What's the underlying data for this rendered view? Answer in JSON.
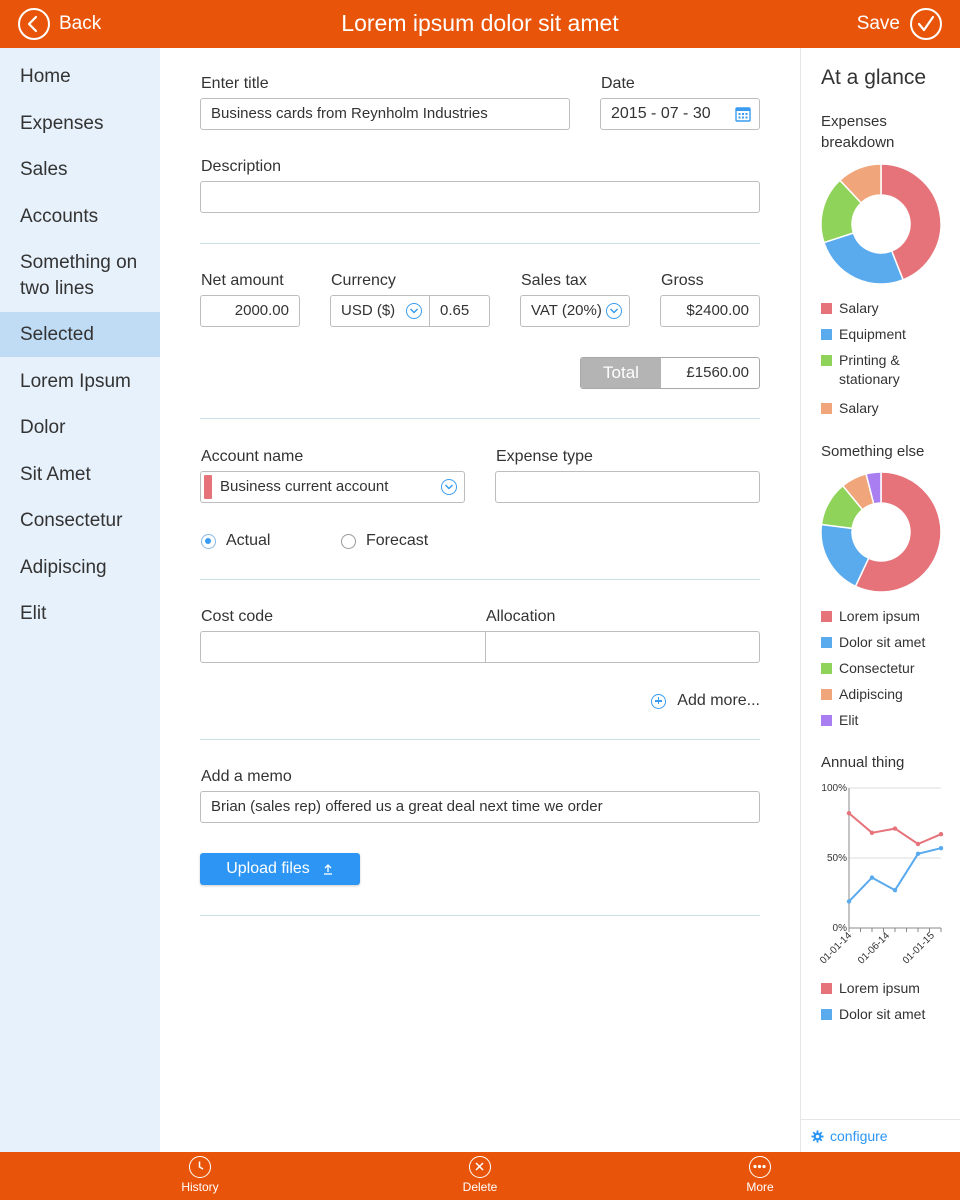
{
  "header": {
    "back_label": "Back",
    "title": "Lorem ipsum dolor sit amet",
    "save_label": "Save",
    "color": "#e8550a"
  },
  "sidebar": {
    "items": [
      {
        "label": "Home"
      },
      {
        "label": "Expenses"
      },
      {
        "label": "Sales"
      },
      {
        "label": "Accounts"
      },
      {
        "label_line1": "Something on",
        "label_line2": "two lines"
      },
      {
        "label": "Selected",
        "selected": true
      },
      {
        "label": "Lorem Ipsum"
      },
      {
        "label": "Dolor"
      },
      {
        "label": "Sit Amet"
      },
      {
        "label": "Consectetur"
      },
      {
        "label": "Adipiscing"
      },
      {
        "label": "Elit"
      }
    ]
  },
  "form": {
    "title_label": "Enter title",
    "title_value": "Business cards from Reynholm Industries",
    "date_label": "Date",
    "date_value": "2015 - 07 - 30",
    "description_label": "Description",
    "description_value": "",
    "net_amount_label": "Net amount",
    "net_amount_value": "2000.00",
    "currency_label": "Currency",
    "currency_value": "USD ($)",
    "exchange_rate": "0.65",
    "sales_tax_label": "Sales tax",
    "sales_tax_value": "VAT (20%)",
    "gross_label": "Gross",
    "gross_value": "$2400.00",
    "total_label": "Total",
    "total_value": "£1560.00",
    "account_name_label": "Account name",
    "account_name_value": "Business current account",
    "expense_type_label": "Expense type",
    "expense_type_value": "",
    "radio_actual": "Actual",
    "radio_forecast": "Forecast",
    "radio_selected": "Actual",
    "cost_code_label": "Cost code",
    "cost_code_value": "",
    "allocation_label": "Allocation",
    "allocation_value": "",
    "add_more_label": "Add more...",
    "memo_label": "Add a memo",
    "memo_value": "Brian (sales rep) offered us a great deal next time we order",
    "upload_label": "Upload files"
  },
  "panel": {
    "title": "At a glance",
    "configure_label": "configure"
  },
  "chart_data": [
    {
      "type": "pie",
      "title_line1": "Expenses",
      "title_line2": "breakdown",
      "labels": [
        "Salary",
        "Equipment",
        "Printing & stationary",
        "Salary"
      ],
      "legend_lines": [
        [
          "Salary"
        ],
        [
          "Equipment"
        ],
        [
          "Printing &",
          "stationary"
        ],
        [
          "Salary"
        ]
      ],
      "values": [
        44,
        26,
        18,
        12
      ],
      "colors": [
        "#e6737a",
        "#5aaaee",
        "#8fd35a",
        "#f0a57a"
      ]
    },
    {
      "type": "pie",
      "title": "Something else",
      "labels": [
        "Lorem ipsum",
        "Dolor sit amet",
        "Consectetur",
        "Adipiscing",
        "Elit"
      ],
      "values": [
        57,
        20,
        12,
        7,
        4
      ],
      "colors": [
        "#e6737a",
        "#5aaaee",
        "#8fd35a",
        "#f0a57a",
        "#a87ef0"
      ]
    },
    {
      "type": "line",
      "title": "Annual thing",
      "x": [
        "01-01-14",
        "",
        "",
        "",
        "01-06-14",
        "",
        "",
        "01-01-15",
        ""
      ],
      "x_tick_labels": [
        "01-01-14",
        "01-06-14",
        "01-01-15"
      ],
      "y_tick_labels": [
        "100%",
        "50%",
        "0%"
      ],
      "ylim": [
        0,
        100
      ],
      "series": [
        {
          "name": "Lorem ipsum",
          "color": "#e6737a",
          "values": [
            82,
            68,
            71,
            60,
            67
          ]
        },
        {
          "name": "Dolor sit amet",
          "color": "#5aaaee",
          "values": [
            19,
            36,
            27,
            53,
            57
          ]
        }
      ]
    }
  ],
  "bottom_bar": {
    "history_label": "History",
    "delete_label": "Delete",
    "more_label": "More"
  }
}
